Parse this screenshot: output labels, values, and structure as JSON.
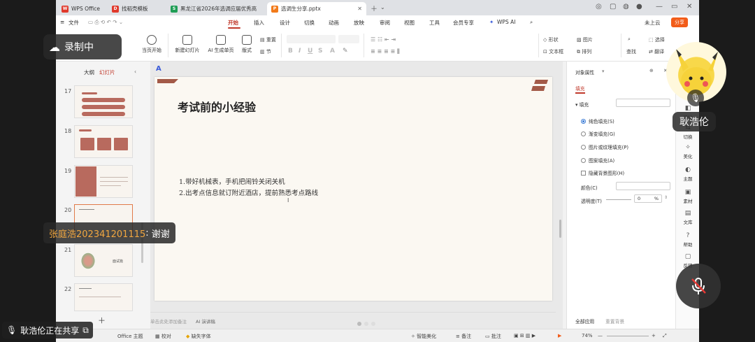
{
  "tabs": [
    {
      "label": "WPS Office",
      "icon": "wps-icon",
      "color": "#e0392b"
    },
    {
      "label": "找稻壳模板",
      "icon": "docer-icon",
      "color": "#e0392b"
    },
    {
      "label": "黑龙江省2026年选调应届优秀高",
      "icon": "sheet-icon",
      "color": "#1f9d55"
    },
    {
      "label": "选调生分享.pptx",
      "icon": "ppt-icon",
      "color": "#f27a1a"
    }
  ],
  "menu": {
    "file": "文件",
    "items": [
      "开始",
      "插入",
      "设计",
      "切换",
      "动画",
      "放映",
      "审阅",
      "视图",
      "工具",
      "会员专享"
    ],
    "active": "开始",
    "wps_ai": "WPS AI",
    "cloud": "未上云",
    "share": "分享"
  },
  "ribbon": {
    "play_from_current": "当页开始",
    "new_slide": "新建幻灯片",
    "ai_single": "AI 生成单页",
    "layout": "版式",
    "section": "节",
    "reset": "重置",
    "shape": "形状",
    "picture": "图片",
    "find": "查找",
    "select": "选择",
    "textbox": "文本框",
    "arrange": "排列",
    "translate": "翻译"
  },
  "thumb_panel": {
    "tab_outline": "大纲",
    "tab_slides": "幻灯片",
    "slides": [
      {
        "num": "17"
      },
      {
        "num": "18"
      },
      {
        "num": "19"
      },
      {
        "num": "20",
        "selected": true
      },
      {
        "num": "21",
        "text": "面试篇"
      },
      {
        "num": "22"
      }
    ]
  },
  "slide": {
    "title": "考试前的小经验",
    "lines": [
      "1.带好机械表，手机把闹铃关闭关机",
      "2.出考点信息就订附近酒店，提前熟悉考点路线"
    ],
    "notes_placeholder": "单击此处添加备注",
    "ai_notes": "AI 演讲稿"
  },
  "properties": {
    "panel_title": "对象属性",
    "tab_fill": "填充",
    "fill_label": "填充",
    "options": [
      {
        "label": "纯色填充(S)",
        "checked": true
      },
      {
        "label": "渐变填充(G)",
        "checked": false
      },
      {
        "label": "图片或纹理填充(P)",
        "checked": false
      },
      {
        "label": "图案填充(A)",
        "checked": false
      }
    ],
    "hide_bg": "隐藏背景图形(H)",
    "color_label": "颜色(C)",
    "transparency_label": "透明度(T)",
    "transparency_value": "0",
    "transparency_unit": "%",
    "apply_all": "全部应用",
    "reset_bg": "重置背景"
  },
  "right_sidebar": [
    {
      "label": "设计",
      "icon": "design-icon"
    },
    {
      "label": "切换",
      "icon": "transition-icon"
    },
    {
      "label": "美化",
      "icon": "beautify-icon"
    },
    {
      "label": "主题",
      "icon": "theme-icon"
    },
    {
      "label": "素材",
      "icon": "material-icon"
    },
    {
      "label": "文库",
      "icon": "library-icon"
    },
    {
      "label": "帮助",
      "icon": "help-icon"
    },
    {
      "label": "反馈",
      "icon": "feedback-icon"
    }
  ],
  "statusbar": {
    "theme": "Office 主题",
    "proofread": "校对",
    "missing_font": "缺失字体",
    "smart_beautify": "智能美化",
    "notes": "备注",
    "comments": "批注",
    "zoom": "74%"
  },
  "overlays": {
    "recording": "录制中",
    "chat_sender": "张庭浩202341201115",
    "chat_sep": ": ",
    "chat_message": "谢谢",
    "sharing_status": "耿浩伦正在共享",
    "participant_name": "耿浩伦"
  },
  "colors": {
    "accent_red": "#c0392b",
    "share_orange": "#f25c19",
    "chat_sender_color": "#f0a640"
  }
}
